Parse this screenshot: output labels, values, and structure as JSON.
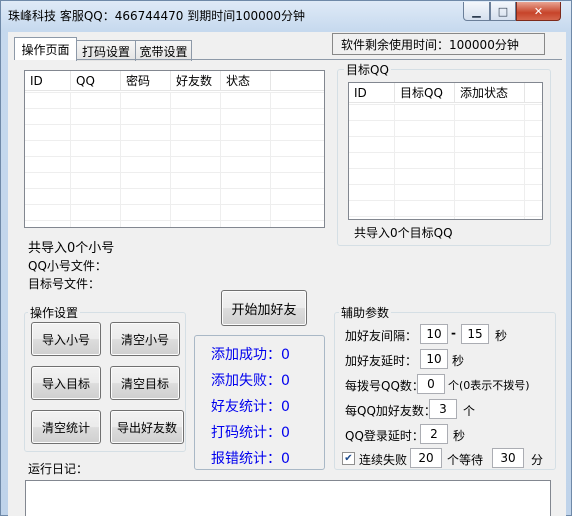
{
  "window": {
    "title": "珠峰科技 客服QQ：466744470  到期时间100000分钟",
    "minimize_glyph": "▁",
    "maximize_glyph": "□",
    "close_glyph": "✕"
  },
  "tabs": [
    {
      "label": "操作页面",
      "active": true
    },
    {
      "label": "打码设置",
      "active": false
    },
    {
      "label": "宽带设置",
      "active": false
    }
  ],
  "license": {
    "label": "软件剩余使用时间：",
    "value": "100000分钟"
  },
  "accounts_table": {
    "columns": [
      "ID",
      "QQ",
      "密码",
      "好友数",
      "状态"
    ],
    "rows": []
  },
  "accounts_summary": "共导入0个小号",
  "qq_file_label": "QQ小号文件：",
  "target_file_label": "目标号文件：",
  "target_group": {
    "label": "目标QQ",
    "columns": [
      "ID",
      "目标QQ",
      "添加状态"
    ],
    "rows": [],
    "summary": "共导入0个目标QQ"
  },
  "ops_group": {
    "label": "操作设置",
    "buttons": {
      "import_accounts": "导入小号",
      "clear_accounts": "清空小号",
      "import_targets": "导入目标",
      "clear_targets": "清空目标",
      "clear_stats": "清空统计",
      "export_friends": "导出好友数"
    }
  },
  "start_button": "开始加好友",
  "stats": [
    {
      "label": "添加成功：",
      "value": "0"
    },
    {
      "label": "添加失败：",
      "value": "0"
    },
    {
      "label": "好友统计：",
      "value": "0"
    },
    {
      "label": "打码统计：",
      "value": "0"
    },
    {
      "label": "报错统计：",
      "value": "0"
    }
  ],
  "aux_group": {
    "label": "辅助参数",
    "interval_label": "加好友间隔：",
    "interval_min": "10",
    "interval_sep": "-",
    "interval_max": "15",
    "interval_unit": "秒",
    "delay_label": "加好友延时：",
    "delay_value": "10",
    "delay_unit": "秒",
    "dial_label": "每拨号QQ数：",
    "dial_value": "0",
    "dial_unit": "个(0表示不拨号)",
    "per_qq_label": "每QQ加好友数：",
    "per_qq_value": "3",
    "per_qq_unit": "个",
    "login_delay_label": "QQ登录延时：",
    "login_delay_value": "2",
    "login_delay_unit": "秒",
    "fail_checked": true,
    "fail_label": "连续失败",
    "fail_count": "20",
    "fail_mid": "个等待",
    "fail_wait": "30",
    "fail_unit": "分"
  },
  "log_label": "运行日记："
}
